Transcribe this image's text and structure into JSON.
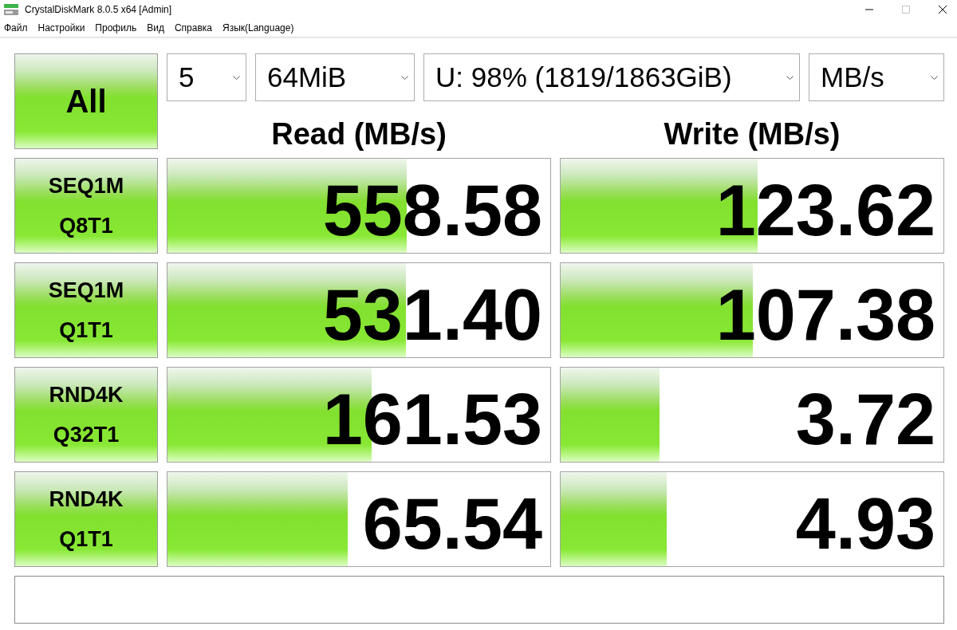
{
  "window": {
    "title": "CrystalDiskMark 8.0.5 x64 [Admin]",
    "controls": [
      {
        "kind": "minimize",
        "disabled": false
      },
      {
        "kind": "maximize",
        "disabled": true
      },
      {
        "kind": "close",
        "disabled": false
      }
    ]
  },
  "menu": [
    "Файл",
    "Настройки",
    "Профиль",
    "Вид",
    "Справка",
    "Язык(Language)"
  ],
  "all_button": "All",
  "dropdowns": [
    "5",
    "64MiB",
    "U: 98% (1819/1863GiB)",
    "MB/s"
  ],
  "headers": {
    "read": "Read (MB/s)",
    "write": "Write (MB/s)"
  },
  "tests": [
    {
      "label": [
        "SEQ1M",
        "Q8T1"
      ],
      "read": {
        "value": "558.58",
        "level": 0.624
      },
      "write": {
        "value": "123.62",
        "level": 0.514
      }
    },
    {
      "label": [
        "SEQ1M",
        "Q1T1"
      ],
      "read": {
        "value": "531.40",
        "level": 0.622
      },
      "write": {
        "value": "107.38",
        "level": 0.503
      }
    },
    {
      "label": [
        "RND4K",
        "Q32T1"
      ],
      "read": {
        "value": "161.53",
        "level": 0.534
      },
      "write": {
        "value": "3.72",
        "level": 0.259
      }
    },
    {
      "label": [
        "RND4K",
        "Q1T1"
      ],
      "read": {
        "value": "65.54",
        "level": 0.47
      },
      "write": {
        "value": "4.93",
        "level": 0.278
      }
    }
  ]
}
